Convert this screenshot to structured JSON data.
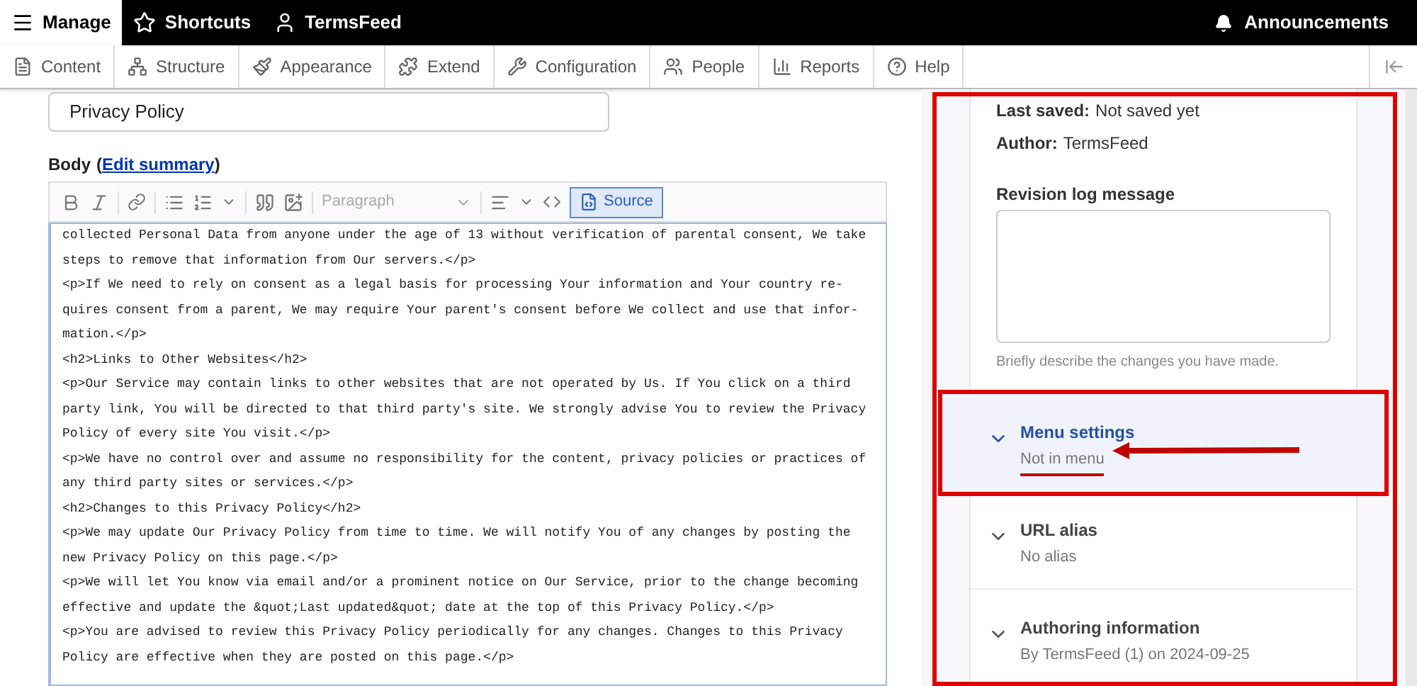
{
  "toolbar": {
    "items": [
      {
        "label": "Manage",
        "selected": true,
        "kind": "menu"
      },
      {
        "label": "Shortcuts",
        "selected": false,
        "kind": "star"
      },
      {
        "label": "TermsFeed",
        "selected": false,
        "kind": "user"
      }
    ],
    "announcements": "Announcements"
  },
  "admin_menu": [
    {
      "label": "Content",
      "kind": "content"
    },
    {
      "label": "Structure",
      "kind": "structure"
    },
    {
      "label": "Appearance",
      "kind": "appearance"
    },
    {
      "label": "Extend",
      "kind": "extend"
    },
    {
      "label": "Configuration",
      "kind": "configuration"
    },
    {
      "label": "People",
      "kind": "people"
    },
    {
      "label": "Reports",
      "kind": "reports"
    },
    {
      "label": "Help",
      "kind": "help"
    }
  ],
  "title_field": {
    "value": "Privacy Policy"
  },
  "body": {
    "label": "Body",
    "link_open": "(",
    "link": "Edit summary",
    "link_close": ")",
    "format_select": "Paragraph",
    "source_button": {
      "label": "Source",
      "selected": true
    },
    "source_lines": [
      "collected Personal Data from anyone under the age of 13 without verification of parental consent, We take",
      "steps to remove that information from Our servers.</p>",
      "<p>If We need to rely on consent as a legal basis for processing Your information and Your country re-",
      "quires consent from a parent, We may require Your parent's consent before We collect and use that infor-",
      "mation.</p>",
      "<h2>Links to Other Websites</h2>",
      "<p>Our Service may contain links to other websites that are not operated by Us. If You click on a third",
      "party link, You will be directed to that third party's site. We strongly advise You to review the Privacy",
      "Policy of every site You visit.</p>",
      "<p>We have no control over and assume no responsibility for the content, privacy policies or practices of",
      "any third party sites or services.</p>",
      "<h2>Changes to this Privacy Policy</h2>",
      "<p>We may update Our Privacy Policy from time to time. We will notify You of any changes by posting the",
      "new Privacy Policy on this page.</p>",
      "<p>We will let You know via email and/or a prominent notice on Our Service, prior to the change becoming",
      "effective and update the &quot;Last updated&quot; date at the top of this Privacy Policy.</p>",
      "<p>You are advised to review this Privacy Policy periodically for any changes. Changes to this Privacy",
      "Policy are effective when they are posted on this page.</p>"
    ]
  },
  "sidebar": {
    "last_saved_label": "Last saved:",
    "last_saved_value": "Not saved yet",
    "author_label": "Author:",
    "author_value": "TermsFeed",
    "revision_label": "Revision log message",
    "revision_hint": "Briefly describe the changes you have made.",
    "sections": [
      {
        "title": "Menu settings",
        "summary": "Not in menu",
        "selected": true
      },
      {
        "title": "URL alias",
        "summary": "No alias",
        "selected": false
      },
      {
        "title": "Authoring information",
        "summary": "By TermsFeed (1) on 2024-09-25",
        "selected": false
      }
    ]
  }
}
